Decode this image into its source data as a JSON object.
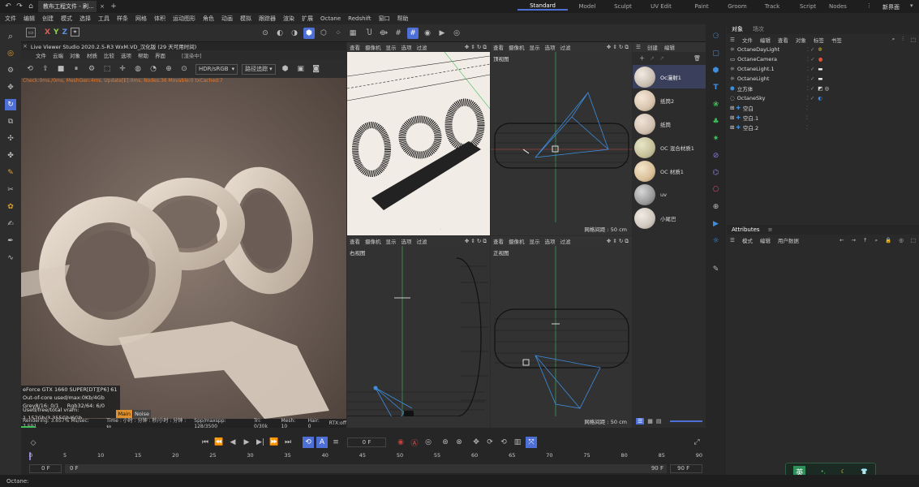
{
  "titlebar": {
    "file_tab": "教布工程文件 - 刷...",
    "layouts": [
      "Standard",
      "Model",
      "Sculpt",
      "UV Edit",
      "Paint",
      "Groom",
      "Track",
      "Script",
      "Nodes"
    ],
    "active_layout": "Standard",
    "new_layout": "新界面"
  },
  "menubar": {
    "items": [
      "文件",
      "编辑",
      "创建",
      "模式",
      "选择",
      "工具",
      "样条",
      "网格",
      "体积",
      "运动图形",
      "角色",
      "动画",
      "模拟",
      "跟踪器",
      "渲染",
      "扩展",
      "Octane",
      "Redshift",
      "窗口",
      "帮助"
    ]
  },
  "toolbar": {
    "axes": [
      "X",
      "Y",
      "Z"
    ]
  },
  "viewer": {
    "title": "Live Viewer Studio 2020.2.5-R3  WxM.VD_汉化版 (29 天可用时间)",
    "menu": [
      "文件",
      "云端",
      "对象",
      "材质",
      "比较",
      "选项",
      "帮助",
      "界面"
    ],
    "status": "[渲染中]",
    "colorspace": "HDR/sRGB",
    "tracking": "路径追踪",
    "info_line": "Check:0ms./0ms, MeshGen:4ms, Update[E]:0ms, Nodes:36 Movable:0 txCached:7",
    "gpu": "eForce GTX 1660 SUPER[DT][P6]    61",
    "out_of_core": "Out-of-core used/max:0Kb/4Gb",
    "grey": "Grey8/16: 0/1",
    "rgb": "Rgb32/64: 6/0",
    "vram": "Used/free/total vram: 1.157Gb/3.355Gb/6Gb",
    "badge_main": "Main",
    "badge_noise": "Noise",
    "rendering": "Rendering: 3.657%  Ms/sec: 7.591",
    "time": "Time : 小时 : 分钟 : 秒/小时 : 分钟 : 秒",
    "spp": "Spp/maxspp: 128/3500",
    "tri": "Tri: 0/30k",
    "mesh": "Mesh: 10",
    "hair": "Hair: 0",
    "rtx": "RTX:off"
  },
  "viewport": {
    "menu": [
      "查看",
      "摄像机",
      "显示",
      "选项",
      "过滤",
      "面板"
    ],
    "top_label": "顶视图",
    "right_label": "右视图",
    "front_label": "正视图",
    "grid": "网格间距 : 50 cm"
  },
  "materials": {
    "menu": [
      "创建",
      "编辑"
    ],
    "items": [
      {
        "name": "Oc漫射1",
        "active": true
      },
      {
        "name": "纸筒2",
        "active": false
      },
      {
        "name": "纸筒",
        "active": false
      },
      {
        "name": "OC 混合材质1",
        "active": false
      },
      {
        "name": "OC 材质1",
        "active": false
      },
      {
        "name": "uv",
        "active": false
      },
      {
        "name": "小尾巴",
        "active": false
      }
    ]
  },
  "objects": {
    "tabs": [
      "对象",
      "场次"
    ],
    "menu": [
      "文件",
      "编辑",
      "查看",
      "对象",
      "标签",
      "书签"
    ],
    "rows": [
      {
        "name": "OctaneDayLight"
      },
      {
        "name": "OctaneCamera"
      },
      {
        "name": "OctaneLight.1"
      },
      {
        "name": "OctaneLight"
      },
      {
        "name": "立方体"
      },
      {
        "name": "OctaneSky"
      },
      {
        "name": "空白"
      },
      {
        "name": "空白.1"
      },
      {
        "name": "空白.2"
      }
    ]
  },
  "attributes": {
    "title": "Attributes",
    "menu": [
      "模式",
      "编辑",
      "用户数据"
    ]
  },
  "timeline": {
    "frame": "0 F",
    "ticks": [
      "0",
      "5",
      "10",
      "15",
      "20",
      "25",
      "30",
      "35",
      "40",
      "45",
      "50",
      "55",
      "60",
      "65",
      "70",
      "75",
      "80",
      "85",
      "90"
    ],
    "start": "0 F",
    "start2": "0 F",
    "end": "90 F",
    "end2": "90 F"
  },
  "statusbar": {
    "text": "Octane:"
  },
  "ime": {
    "lang": "英"
  },
  "colors": {
    "accent": "#4d6fd6",
    "blue_icon": "#3d8ee0",
    "green_icon": "#3fbf5a"
  }
}
